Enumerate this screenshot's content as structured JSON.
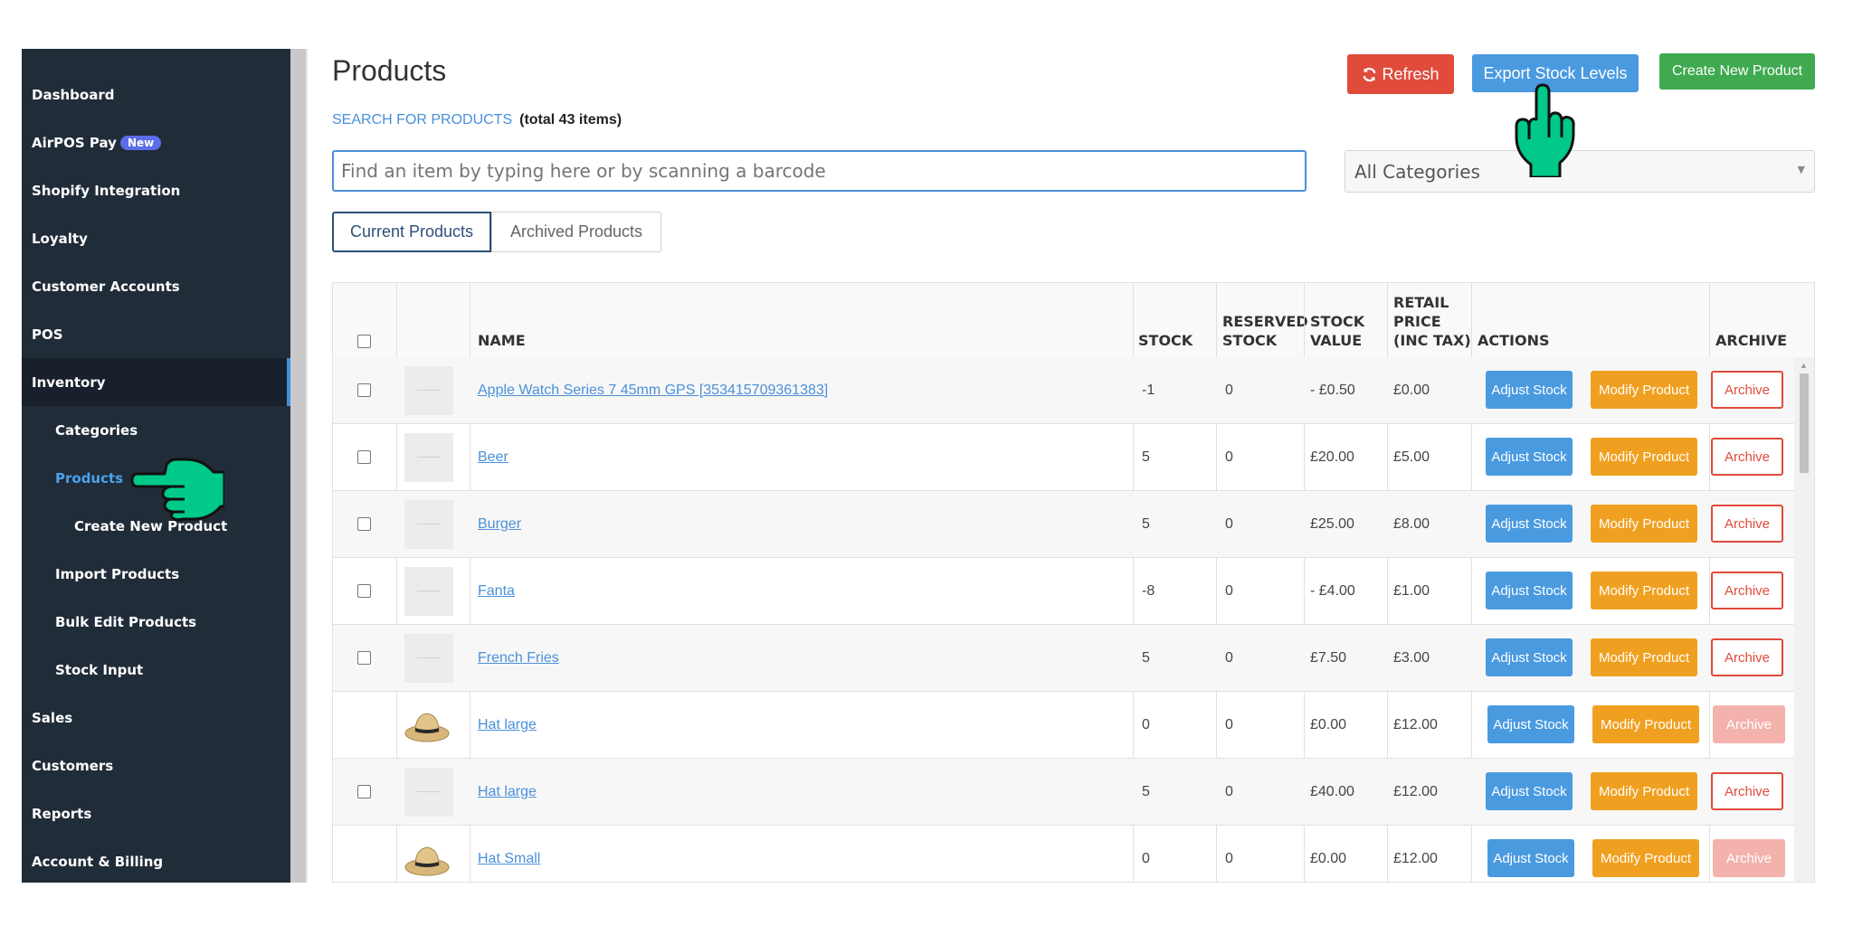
{
  "sidebar": {
    "items": [
      {
        "label": "Dashboard"
      },
      {
        "label": "AirPOS Pay",
        "badge": "New"
      },
      {
        "label": "Shopify Integration"
      },
      {
        "label": "Loyalty"
      },
      {
        "label": "Customer Accounts"
      },
      {
        "label": "POS"
      },
      {
        "label": "Inventory"
      },
      {
        "label": "Categories"
      },
      {
        "label": "Products"
      },
      {
        "label": "Create New Product"
      },
      {
        "label": "Import Products"
      },
      {
        "label": "Bulk Edit Products"
      },
      {
        "label": "Stock Input"
      },
      {
        "label": "Sales"
      },
      {
        "label": "Customers"
      },
      {
        "label": "Reports"
      },
      {
        "label": "Account & Billing"
      }
    ]
  },
  "header": {
    "title": "Products",
    "search_link": "SEARCH FOR PRODUCTS",
    "total": "(total 43 items)",
    "refresh_label": "Refresh",
    "export_label": "Export Stock Levels",
    "create_label": "Create New Product"
  },
  "search": {
    "placeholder": "Find an item by typing here or by scanning a barcode",
    "category": "All Categories"
  },
  "tabs": [
    {
      "label": "Current Products"
    },
    {
      "label": "Archived Products"
    }
  ],
  "table": {
    "headers": {
      "name": "NAME",
      "stock": "STOCK",
      "reserved": "RESERVED\nSTOCK",
      "value": "STOCK\nVALUE",
      "retail": "RETAIL\nPRICE\n(INC TAX)",
      "actions": "ACTIONS",
      "archive": "ARCHIVE"
    },
    "actions": {
      "adjust": "Adjust Stock",
      "modify": "Modify Product",
      "archive": "Archive"
    },
    "rows": [
      {
        "name": "Apple Watch Series 7 45mm GPS [353415709361383]",
        "stock": "-1",
        "reserved": "0",
        "value": "- £0.50",
        "price": "£0.00",
        "checkbox": true,
        "image": "placeholder",
        "archivable": true
      },
      {
        "name": "Beer",
        "stock": "5",
        "reserved": "0",
        "value": "£20.00",
        "price": "£5.00",
        "checkbox": true,
        "image": "placeholder",
        "archivable": true
      },
      {
        "name": "Burger",
        "stock": "5",
        "reserved": "0",
        "value": "£25.00",
        "price": "£8.00",
        "checkbox": true,
        "image": "placeholder",
        "archivable": true
      },
      {
        "name": "Fanta",
        "stock": "-8",
        "reserved": "0",
        "value": "- £4.00",
        "price": "£1.00",
        "checkbox": true,
        "image": "placeholder",
        "archivable": true
      },
      {
        "name": "French Fries",
        "stock": "5",
        "reserved": "0",
        "value": "£7.50",
        "price": "£3.00",
        "checkbox": true,
        "image": "placeholder",
        "archivable": true
      },
      {
        "name": "Hat large",
        "stock": "0",
        "reserved": "0",
        "value": "£0.00",
        "price": "£12.00",
        "checkbox": false,
        "image": "hat",
        "archivable": false
      },
      {
        "name": "Hat large",
        "stock": "5",
        "reserved": "0",
        "value": "£40.00",
        "price": "£12.00",
        "checkbox": true,
        "image": "placeholder",
        "archivable": true
      },
      {
        "name": "Hat Small",
        "stock": "0",
        "reserved": "0",
        "value": "£0.00",
        "price": "£12.00",
        "checkbox": false,
        "image": "hat",
        "archivable": false
      }
    ]
  },
  "icons": {
    "refresh": "refresh-icon",
    "pointer": "pointing-hand-icon"
  },
  "colors": {
    "sidebar_bg": "#212c39",
    "refresh": "#e04b3c",
    "export": "#4a9ae0",
    "create": "#3faa50",
    "modify": "#f0a020",
    "link": "#4a90d9",
    "hand": "#00c98a"
  }
}
